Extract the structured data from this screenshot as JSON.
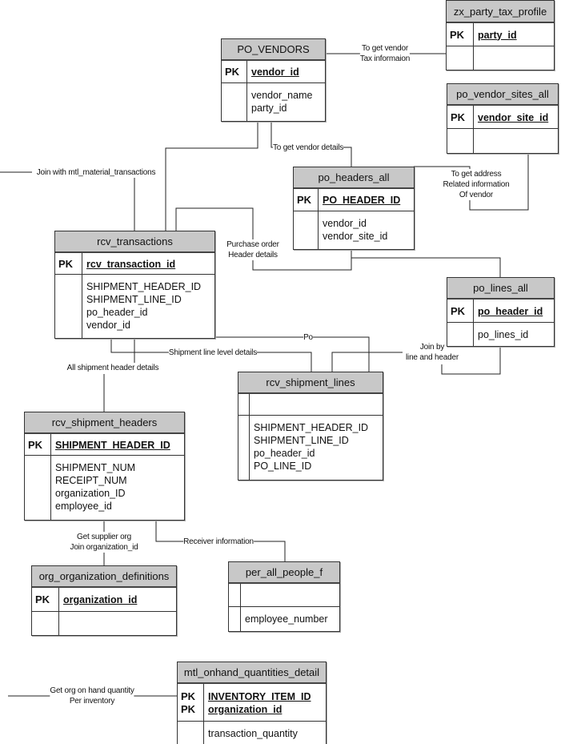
{
  "tables": [
    {
      "id": "zx_party_tax_profile",
      "title": "zx_party_tax_profile",
      "pk": [
        "party_id"
      ],
      "fields": []
    },
    {
      "id": "po_vendors",
      "title": "PO_VENDORS",
      "pk": [
        "vendor_id"
      ],
      "fields": [
        "vendor_name",
        "party_id"
      ]
    },
    {
      "id": "po_vendor_sites_all",
      "title": "po_vendor_sites_all",
      "pk": [
        "vendor_site_id"
      ],
      "fields": []
    },
    {
      "id": "po_headers_all",
      "title": "po_headers_all",
      "pk": [
        "PO_HEADER_ID"
      ],
      "fields": [
        "vendor_id",
        "vendor_site_id"
      ]
    },
    {
      "id": "rcv_transactions",
      "title": "rcv_transactions",
      "pk": [
        "rcv_transaction_id"
      ],
      "fields": [
        "SHIPMENT_HEADER_ID",
        "SHIPMENT_LINE_ID",
        "po_header_id",
        "vendor_id"
      ]
    },
    {
      "id": "po_lines_all",
      "title": "po_lines_all",
      "pk": [
        "po_header_id"
      ],
      "fields": [
        "po_lines_id"
      ]
    },
    {
      "id": "rcv_shipment_lines",
      "title": "rcv_shipment_lines",
      "pk": [],
      "fields": [
        "SHIPMENT_HEADER_ID",
        "SHIPMENT_LINE_ID",
        "po_header_id",
        "PO_LINE_ID"
      ]
    },
    {
      "id": "rcv_shipment_headers",
      "title": "rcv_shipment_headers",
      "pk": [
        "SHIPMENT_HEADER_ID"
      ],
      "fields": [
        "SHIPMENT_NUM",
        "RECEIPT_NUM",
        "organization_ID",
        "employee_id"
      ]
    },
    {
      "id": "org_organization_definitions",
      "title": "org_organization_definitions",
      "pk": [
        "organization_id"
      ],
      "fields": []
    },
    {
      "id": "per_all_people_f",
      "title": "per_all_people_f",
      "pk": [],
      "fields": [
        "employee_number"
      ]
    },
    {
      "id": "mtl_onhand_quantities_detail",
      "title": "mtl_onhand_quantities_detail",
      "pk": [
        "INVENTORY_ITEM_ID",
        "organization_id"
      ],
      "fields": [
        "transaction_quantity"
      ]
    }
  ],
  "pk_label": "PK",
  "labels": {
    "tax": "To get vendor\nTax informaion",
    "vendor_details": "To get vendor details",
    "mtl": "Join with mtl_material_transactions",
    "address": "To get address\nRelated information\nOf vendor",
    "po_header": "Purchase order\nHeader details",
    "po": "Po",
    "shipment_line": "Shipment line level details",
    "join_line_header": "Join by\nline and header",
    "shipment_header": "All shipment header details",
    "supplier_org": "Get supplier org\nJoin organization_id",
    "receiver": "Receiver information",
    "onhand": "Get org on hand quantity\nPer inventory"
  }
}
